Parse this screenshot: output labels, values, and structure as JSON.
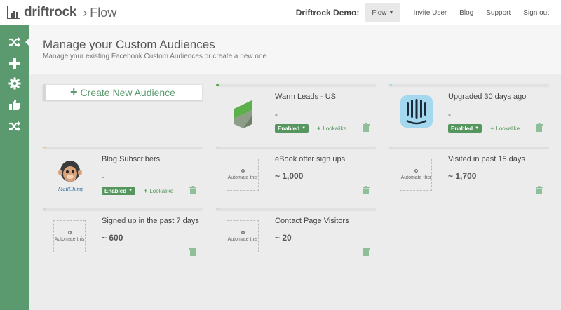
{
  "brand": {
    "name": "driftrock",
    "section": "Flow"
  },
  "nav": {
    "demo_label": "Driftrock Demo:",
    "flow_select": "Flow",
    "links": [
      "Invite User",
      "Blog",
      "Support",
      "Sign out"
    ]
  },
  "sidebar": {
    "items": [
      {
        "icon": "shuffle-icon",
        "active": true
      },
      {
        "icon": "plus-icon",
        "active": false
      },
      {
        "icon": "gear-icon",
        "active": false
      },
      {
        "icon": "thumbs-up-icon",
        "active": false
      },
      {
        "icon": "shuffle-icon",
        "active": false
      }
    ]
  },
  "page": {
    "title": "Manage your Custom Audiences",
    "subtitle": "Manage your existing Facebook Custom Audiences or create a new one"
  },
  "colors": {
    "brand_green": "#5a9a6e",
    "badge_green": "#55965f",
    "accent_green": "#5ca24d",
    "accent_blue": "#a9dcea",
    "accent_yellow": "#f5cd47"
  },
  "create": {
    "label": "Create New Audience"
  },
  "audiences": [
    {
      "title": "Warm Leads - US",
      "count": "-",
      "status": "Enabled",
      "lookalike": "Lookalike",
      "icon": "warm-leads-logo-icon"
    },
    {
      "title": "Upgraded 30 days ago",
      "count": "-",
      "status": "Enabled",
      "lookalike": "Lookalike",
      "icon": "intercom-logo-icon"
    },
    {
      "title": "Blog Subscribers",
      "count": "-",
      "status": "Enabled",
      "lookalike": "Lookalike",
      "icon": "mailchimp-logo-icon",
      "logo_text": "MailChimp"
    },
    {
      "title": "eBook offer sign ups",
      "count": "~ 1,000",
      "automate": "Automate this"
    },
    {
      "title": "Visited in past 15 days",
      "count": "~ 1,700",
      "automate": "Automate this"
    },
    {
      "title": "Signed up in the past 7 days",
      "count": "~ 600",
      "automate": "Automate this"
    },
    {
      "title": "Contact Page Visitors",
      "count": "~ 20",
      "automate": "Automate this"
    }
  ]
}
